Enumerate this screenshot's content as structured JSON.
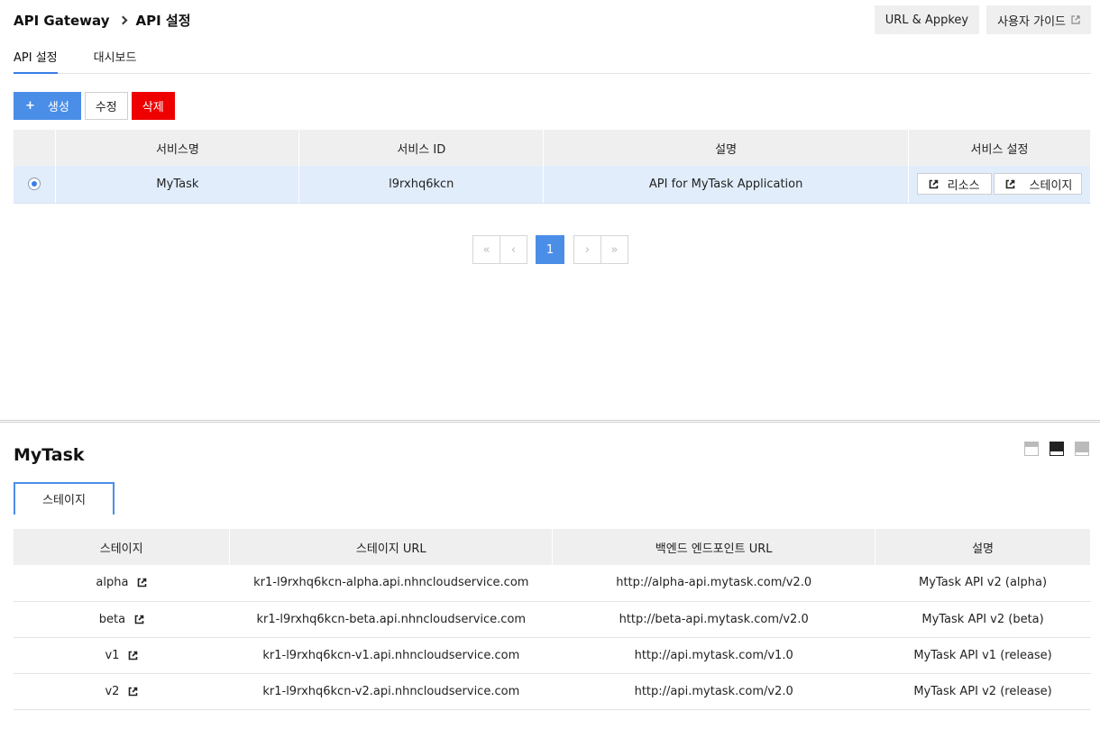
{
  "breadcrumb": {
    "root": "API Gateway",
    "current": "API 설정"
  },
  "header_buttons": {
    "appkey": "URL & Appkey",
    "guide": "사용자 가이드"
  },
  "tabs": [
    {
      "label": "API 설정",
      "active": true
    },
    {
      "label": "대시보드",
      "active": false
    }
  ],
  "actions": {
    "create": "생성",
    "create_icon": "+",
    "edit": "수정",
    "delete": "삭제"
  },
  "service_table": {
    "headers": [
      "서비스명",
      "서비스 ID",
      "설명",
      "서비스 설정"
    ],
    "rows": [
      {
        "name": "MyTask",
        "id": "l9rxhq6kcn",
        "description": "API for MyTask Application",
        "resource_btn": "리소스",
        "stage_btn": "스테이지"
      }
    ]
  },
  "pager": {
    "first": "«",
    "prev": "‹",
    "page": "1",
    "next": "›",
    "last": "»"
  },
  "detail": {
    "title": "MyTask",
    "subtab": "스테이지",
    "headers": [
      "스테이지",
      "스테이지 URL",
      "백엔드 엔드포인트 URL",
      "설명"
    ],
    "rows": [
      {
        "stage": "alpha",
        "url": "kr1-l9rxhq6kcn-alpha.api.nhncloudservice.com",
        "backend": "http://alpha-api.mytask.com/v2.0",
        "desc": "MyTask API v2 (alpha)"
      },
      {
        "stage": "beta",
        "url": "kr1-l9rxhq6kcn-beta.api.nhncloudservice.com",
        "backend": "http://beta-api.mytask.com/v2.0",
        "desc": "MyTask API v2 (beta)"
      },
      {
        "stage": "v1",
        "url": "kr1-l9rxhq6kcn-v1.api.nhncloudservice.com",
        "backend": "http://api.mytask.com/v1.0",
        "desc": "MyTask API v1 (release)"
      },
      {
        "stage": "v2",
        "url": "kr1-l9rxhq6kcn-v2.api.nhncloudservice.com",
        "backend": "http://api.mytask.com/v2.0",
        "desc": "MyTask API v2 (release)"
      }
    ]
  },
  "colors": {
    "accent": "#4a8ee8",
    "danger": "#ee0000",
    "selected_row": "#e1edfb"
  }
}
